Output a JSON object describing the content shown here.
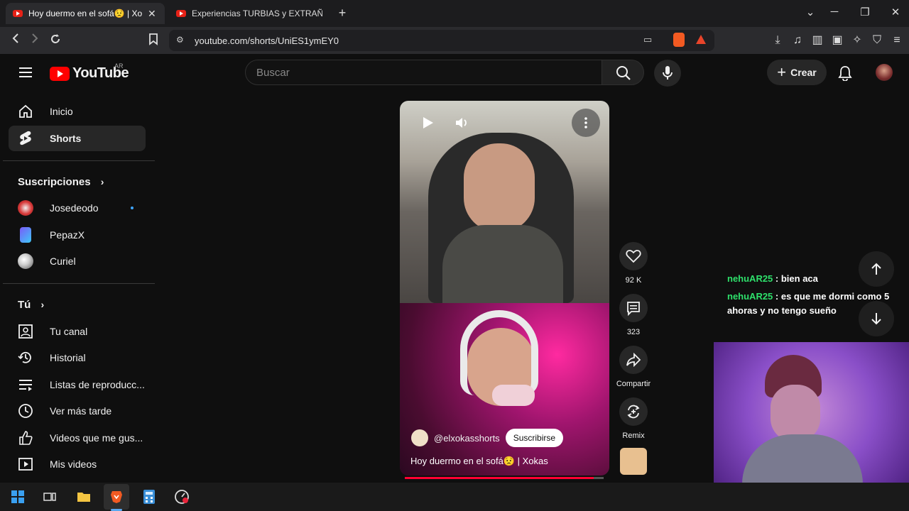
{
  "browser": {
    "tabs": [
      {
        "title": "Hoy duermo en el sofá😟 | Xoka"
      },
      {
        "title": "Experiencias TURBIAS y EXTRAÑAS c"
      }
    ],
    "url": "youtube.com/shorts/UniES1ymEY0"
  },
  "header": {
    "logo_text": "YouTube",
    "region": "AR",
    "search_placeholder": "Buscar",
    "create_label": "Crear"
  },
  "sidebar": {
    "main": [
      {
        "label": "Inicio"
      },
      {
        "label": "Shorts"
      }
    ],
    "subscriptions_title": "Suscripciones",
    "subscriptions": [
      {
        "label": "Josedeodo"
      },
      {
        "label": "PepazX"
      },
      {
        "label": "Curiel"
      }
    ],
    "you_title": "Tú",
    "you": [
      {
        "label": "Tu canal"
      },
      {
        "label": "Historial"
      },
      {
        "label": "Listas de reproducc..."
      },
      {
        "label": "Ver más tarde"
      },
      {
        "label": "Videos que me gus..."
      },
      {
        "label": "Mis videos"
      }
    ]
  },
  "short": {
    "channel": "@elxokasshorts",
    "subscribe_label": "Suscribirse",
    "title": "Hoy duermo en el sofá😟 | Xokas",
    "progress": 0.95,
    "actions": {
      "likes": "92 K",
      "comments": "323",
      "share": "Compartir",
      "remix": "Remix"
    }
  },
  "chat": [
    {
      "user": "nehuAR25",
      "message": "bien aca"
    },
    {
      "user": "nehuAR25",
      "message": "es que me dormi como 5 ahoras y no tengo sueño"
    }
  ],
  "colors": {
    "brand": "#ff0000",
    "chat_user": "#2ee06b",
    "progress": "#ff0033"
  }
}
